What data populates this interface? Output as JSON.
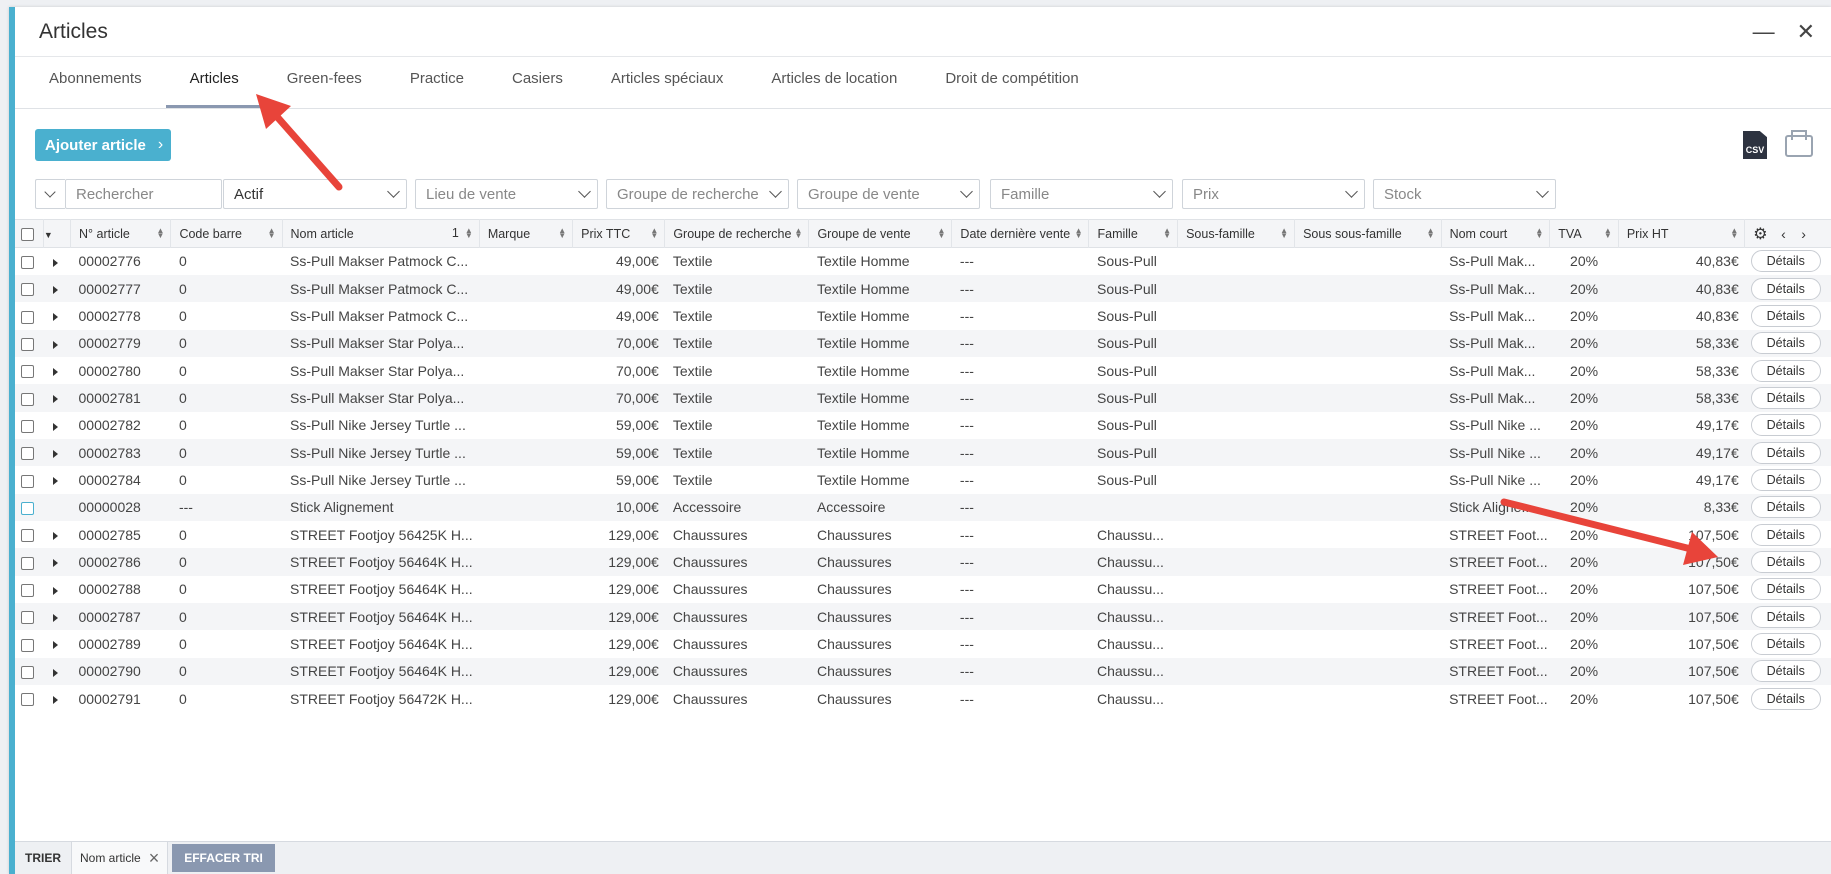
{
  "window": {
    "title": "Articles",
    "minimize": "—",
    "close": "✕"
  },
  "tabs": [
    "Abonnements",
    "Articles",
    "Green-fees",
    "Practice",
    "Casiers",
    "Articles spéciaux",
    "Articles de location",
    "Droit de compétition"
  ],
  "active_tab": "Articles",
  "toolbar": {
    "add_label": "Ajouter article",
    "add_chevron": "›",
    "csv_label": "CSV"
  },
  "filters": {
    "search_placeholder": "Rechercher",
    "status": "Actif",
    "lieu": "Lieu de vente",
    "groupe_recherche": "Groupe de recherche",
    "groupe_vente": "Groupe de vente",
    "famille": "Famille",
    "prix": "Prix",
    "stock": "Stock"
  },
  "columns": [
    "N° article",
    "Code barre",
    "Nom article",
    "Marque",
    "Prix TTC",
    "Groupe de recherche",
    "Groupe de vente",
    "Date dernière vente",
    "Famille",
    "Sous-famille",
    "Sous sous-famille",
    "Nom court",
    "TVA",
    "Prix HT"
  ],
  "sort_index_label": "1",
  "details_label": "Détails",
  "rows": [
    [
      "00002776",
      "0",
      "Ss-Pull Makser Patmock C...",
      "",
      "49,00€",
      "Textile",
      "Textile Homme",
      "---",
      "Sous-Pull",
      "",
      "",
      "Ss-Pull Mak...",
      "20%",
      "40,83€"
    ],
    [
      "00002777",
      "0",
      "Ss-Pull Makser Patmock C...",
      "",
      "49,00€",
      "Textile",
      "Textile Homme",
      "---",
      "Sous-Pull",
      "",
      "",
      "Ss-Pull Mak...",
      "20%",
      "40,83€"
    ],
    [
      "00002778",
      "0",
      "Ss-Pull Makser Patmock C...",
      "",
      "49,00€",
      "Textile",
      "Textile Homme",
      "---",
      "Sous-Pull",
      "",
      "",
      "Ss-Pull Mak...",
      "20%",
      "40,83€"
    ],
    [
      "00002779",
      "0",
      "Ss-Pull Makser Star Polya...",
      "",
      "70,00€",
      "Textile",
      "Textile Homme",
      "---",
      "Sous-Pull",
      "",
      "",
      "Ss-Pull Mak...",
      "20%",
      "58,33€"
    ],
    [
      "00002780",
      "0",
      "Ss-Pull Makser Star Polya...",
      "",
      "70,00€",
      "Textile",
      "Textile Homme",
      "---",
      "Sous-Pull",
      "",
      "",
      "Ss-Pull Mak...",
      "20%",
      "58,33€"
    ],
    [
      "00002781",
      "0",
      "Ss-Pull Makser Star Polya...",
      "",
      "70,00€",
      "Textile",
      "Textile Homme",
      "---",
      "Sous-Pull",
      "",
      "",
      "Ss-Pull Mak...",
      "20%",
      "58,33€"
    ],
    [
      "00002782",
      "0",
      "Ss-Pull Nike Jersey Turtle ...",
      "",
      "59,00€",
      "Textile",
      "Textile Homme",
      "---",
      "Sous-Pull",
      "",
      "",
      "Ss-Pull Nike ...",
      "20%",
      "49,17€"
    ],
    [
      "00002783",
      "0",
      "Ss-Pull Nike Jersey Turtle ...",
      "",
      "59,00€",
      "Textile",
      "Textile Homme",
      "---",
      "Sous-Pull",
      "",
      "",
      "Ss-Pull Nike ...",
      "20%",
      "49,17€"
    ],
    [
      "00002784",
      "0",
      "Ss-Pull Nike Jersey Turtle ...",
      "",
      "59,00€",
      "Textile",
      "Textile Homme",
      "---",
      "Sous-Pull",
      "",
      "",
      "Ss-Pull Nike ...",
      "20%",
      "49,17€"
    ],
    [
      "00000028",
      "---",
      "Stick Alignement",
      "",
      "10,00€",
      "Accessoire",
      "Accessoire",
      "---",
      "",
      "",
      "",
      "Stick Aligne...",
      "20%",
      "8,33€"
    ],
    [
      "00002785",
      "0",
      "STREET Footjoy 56425K H...",
      "",
      "129,00€",
      "Chaussures",
      "Chaussures",
      "---",
      "Chaussu...",
      "",
      "",
      "STREET Foot...",
      "20%",
      "107,50€"
    ],
    [
      "00002786",
      "0",
      "STREET Footjoy 56464K H...",
      "",
      "129,00€",
      "Chaussures",
      "Chaussures",
      "---",
      "Chaussu...",
      "",
      "",
      "STREET Foot...",
      "20%",
      "107,50€"
    ],
    [
      "00002788",
      "0",
      "STREET Footjoy 56464K H...",
      "",
      "129,00€",
      "Chaussures",
      "Chaussures",
      "---",
      "Chaussu...",
      "",
      "",
      "STREET Foot...",
      "20%",
      "107,50€"
    ],
    [
      "00002787",
      "0",
      "STREET Footjoy 56464K H...",
      "",
      "129,00€",
      "Chaussures",
      "Chaussures",
      "---",
      "Chaussu...",
      "",
      "",
      "STREET Foot...",
      "20%",
      "107,50€"
    ],
    [
      "00002789",
      "0",
      "STREET Footjoy 56464K H...",
      "",
      "129,00€",
      "Chaussures",
      "Chaussures",
      "---",
      "Chaussu...",
      "",
      "",
      "STREET Foot...",
      "20%",
      "107,50€"
    ],
    [
      "00002790",
      "0",
      "STREET Footjoy 56464K H...",
      "",
      "129,00€",
      "Chaussures",
      "Chaussures",
      "---",
      "Chaussu...",
      "",
      "",
      "STREET Foot...",
      "20%",
      "107,50€"
    ],
    [
      "00002791",
      "0",
      "STREET Footjoy 56472K H...",
      "",
      "129,00€",
      "Chaussures",
      "Chaussures",
      "---",
      "Chaussu...",
      "",
      "",
      "STREET Foot...",
      "20%",
      "107,50€"
    ]
  ],
  "footer": {
    "sort_label": "TRIER",
    "sort_chip": "Nom article",
    "clear_label": "EFFACER TRI"
  },
  "colors": {
    "accent": "#4ab0cf",
    "annotation_arrow": "#e8443a",
    "clear_button": "#8a98b0"
  }
}
